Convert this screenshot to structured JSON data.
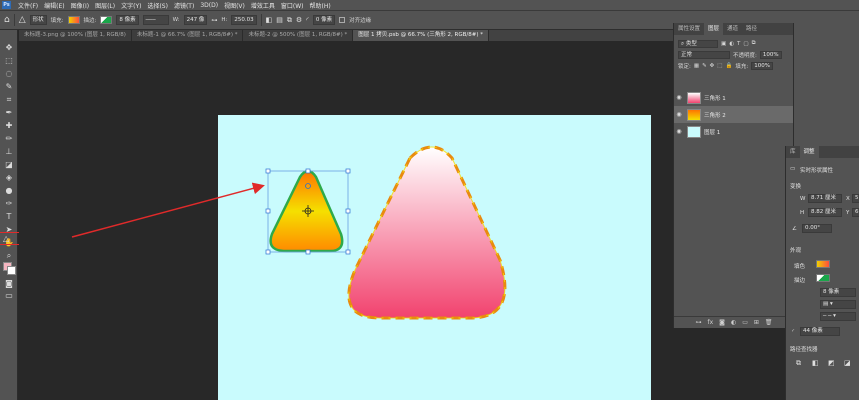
{
  "menubar": {
    "logo": "Ps",
    "items": [
      "文件(F)",
      "编辑(E)",
      "图像(I)",
      "图层(L)",
      "文字(Y)",
      "选择(S)",
      "滤镜(T)",
      "3D(D)",
      "视图(V)",
      "增效工具",
      "窗口(W)",
      "帮助(H)"
    ]
  },
  "options": {
    "mode": "形状",
    "fill_label": "填充:",
    "stroke_label": "描边:",
    "stroke_size": "8 像素",
    "w_label": "W:",
    "w_value": "247 像",
    "h_label": "H:",
    "h_value": "250.03",
    "radius": "0 像素",
    "align_edges": "对齐边缘"
  },
  "tabs": [
    "未标题-3.png @ 100% (图层 1, RGB/8)",
    "未标题-1 @ 66.7% (图层 1, RGB/8#) *",
    "未标题-2 @ 500% (图层 1, RGB/8#) *",
    "图层 1 拷贝.psb @ 66.7% (三角形 2, RGB/8#) *"
  ],
  "layers_panel": {
    "tabs": [
      "属性设置",
      "图层",
      "通道",
      "路径"
    ],
    "filter": "类型",
    "blend_mode": "正常",
    "opacity_label": "不透明度:",
    "opacity": "100%",
    "lock_label": "锁定:",
    "fill_label": "填充:",
    "fill": "100%",
    "layers": [
      {
        "name": "三角形 1",
        "selected": false
      },
      {
        "name": "三角形 2",
        "selected": true
      },
      {
        "name": "图层 1",
        "selected": false
      }
    ]
  },
  "properties": {
    "tabs": [
      "库",
      "调整"
    ],
    "title": "实时形状属性",
    "section_transform": "变换",
    "w_label": "W",
    "w_value": "8.71 厘米",
    "h_label": "H",
    "h_value": "8.82 厘米",
    "x_label": "X",
    "x_value": "5.",
    "y_label": "Y",
    "y_value": "6.",
    "angle": "0.00°",
    "section_appearance": "外观",
    "fill_label": "填色",
    "stroke_label": "描边",
    "stroke_size": "8 像素",
    "corner_radius": "44 像素",
    "pathfinder": "路径查找器"
  },
  "colors": {
    "doc_bg": "#c9fbfd",
    "small_grad_top": "#ff7a00",
    "small_grad_bottom": "#f0e000",
    "small_stroke": "#2eaa4a",
    "big_grad_top": "#ffffff",
    "big_grad_bottom": "#f2426e",
    "big_stroke": "#e88a10",
    "arrow": "#e02a2a"
  }
}
